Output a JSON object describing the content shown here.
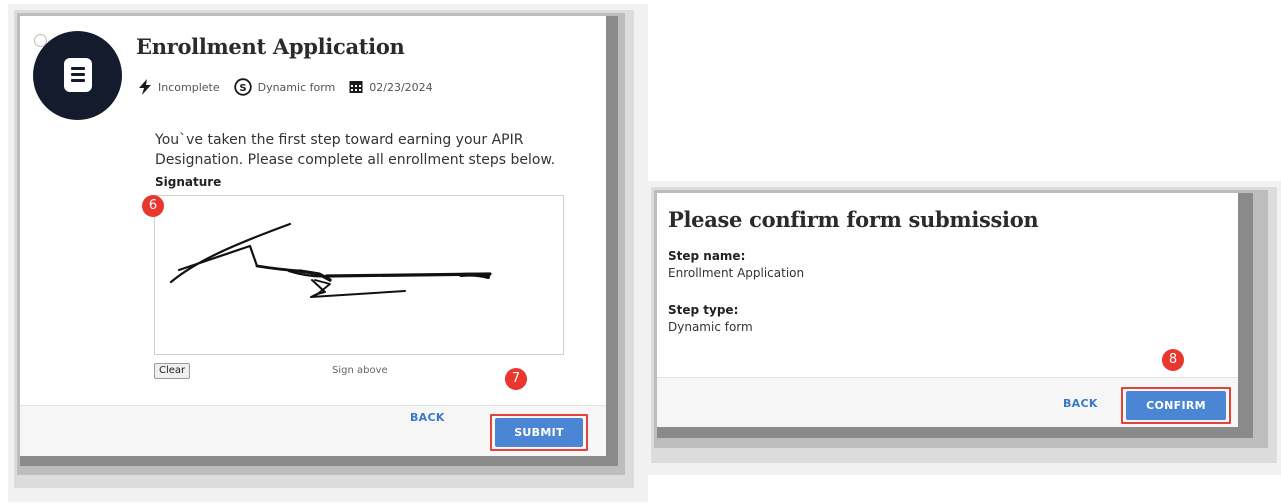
{
  "left_panel": {
    "title": "Enrollment Application",
    "status": "Incomplete",
    "step_type": "Dynamic form",
    "date": "02/23/2024",
    "intro_line1": "You`ve taken the first step toward earning your APIR",
    "intro_line2": "Designation. Please complete all enrollment steps below.",
    "signature_label": "Signature",
    "clear_label": "Clear",
    "sign_hint": "Sign above",
    "back_label": "BACK",
    "submit_label": "SUBMIT"
  },
  "right_panel": {
    "title": "Please confirm form submission",
    "step_name_label": "Step name:",
    "step_name_value": "Enrollment Application",
    "step_type_label": "Step type:",
    "step_type_value": "Dynamic form",
    "back_label": "BACK",
    "confirm_label": "CONFIRM"
  },
  "annotations": {
    "step_6": "6",
    "step_7": "7",
    "step_8": "8"
  },
  "icons": {
    "avatar": "document-icon",
    "status": "lightning-icon",
    "type": "dollar-circle-icon",
    "date": "calendar-icon"
  },
  "colors": {
    "primary": "#4a86d3",
    "highlight": "#e5423b",
    "avatar_bg": "#141b2d",
    "badge": "#e8372f"
  }
}
